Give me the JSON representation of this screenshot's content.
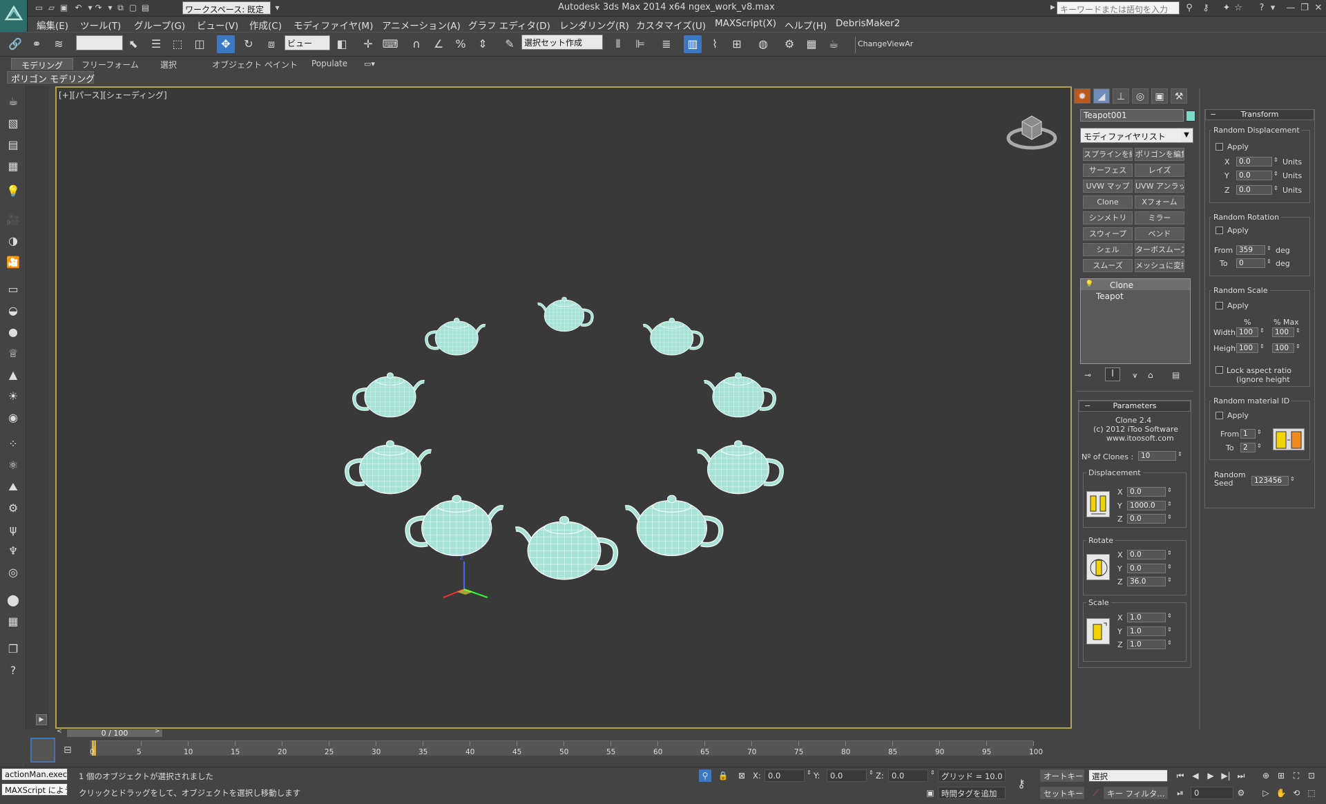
{
  "titlebar": {
    "workspace": "ワークスペース: 既定",
    "title": "Autodesk 3ds Max  2014 x64      ngex_work_v8.max",
    "search_placeholder": "キーワードまたは語句を入力"
  },
  "menu": [
    "編集(E)",
    "ツール(T)",
    "グループ(G)",
    "ビュー(V)",
    "作成(C)",
    "モディファイヤ(M)",
    "アニメーション(A)",
    "グラフ エディタ(D)",
    "レンダリング(R)",
    "カスタマイズ(U)",
    "MAXScript(X)",
    "ヘルプ(H)",
    "DebrisMaker2"
  ],
  "toolbar": {
    "view_dropdown": "ビュー",
    "selection_set": "選択セット作成",
    "change_view": "ChangeViewAr"
  },
  "ribbon": {
    "tabs": [
      "モデリング",
      "フリーフォーム",
      "選択",
      "オブジェクト ペイント",
      "Populate"
    ],
    "panel_label": "ポリゴン モデリング"
  },
  "viewport": {
    "label": "[+][パース][シェーディング]",
    "object_color": "#9be0d0"
  },
  "command_panel": {
    "object_name": "Teapot001",
    "object_color": "#7bd8c6",
    "modifier_list": "モディファイヤリスト",
    "modifier_buttons": [
      "スプラインを編集",
      "ポリゴンを編集",
      "サーフェス",
      "レイズ",
      "UVW マップ",
      "UVW アンラップ",
      "Clone",
      "Xフォーム",
      "シンメトリ",
      "ミラー",
      "スウィープ",
      "ベンド",
      "シェル",
      "ターボスムーズ",
      "スムーズ",
      "メッシュに変換"
    ],
    "stack": [
      "Clone",
      "Teapot"
    ]
  },
  "parameters": {
    "title": "Parameters",
    "about_lines": [
      "Clone 2.4",
      "(c) 2012 iToo Software",
      "www.itoosoft.com"
    ],
    "num_clones_label": "Nº of Clones :",
    "num_clones": "10",
    "displacement_label": "Displacement",
    "displacement": {
      "x": "0.0",
      "y": "1000.0",
      "z": "0.0"
    },
    "rotate_label": "Rotate",
    "rotate": {
      "x": "0.0",
      "y": "0.0",
      "z": "36.0"
    },
    "scale_label": "Scale",
    "scale": {
      "x": "1.0",
      "y": "1.0",
      "z": "1.0"
    },
    "axis_labels": [
      "X",
      "Y",
      "Z"
    ]
  },
  "transform": {
    "title": "Transform",
    "random_displacement": "Random Displacement",
    "apply": "Apply",
    "rd_values": {
      "x": "0.0",
      "y": "0.0",
      "z": "0.0"
    },
    "units": "Units",
    "random_rotation": "Random Rotation",
    "from_label": "From",
    "to_label": "To",
    "rr_from": "359",
    "rr_to": "0",
    "deg": "deg",
    "random_scale": "Random Scale",
    "pct": "%",
    "pct_max": "% Max",
    "width_label": "Width",
    "height_label": "Height",
    "rs_width": "100",
    "rs_width_max": "100",
    "rs_height": "100",
    "rs_height_max": "100",
    "lock_line1": "Lock aspect ratio",
    "lock_line2": "(ignore height",
    "random_material": "Random material ID",
    "rm_from": "1",
    "rm_to": "2",
    "random_seed_line1": "Random",
    "random_seed_line2": "Seed",
    "seed": "123456"
  },
  "timeline": {
    "frame": "0 / 100",
    "ticks": [
      "0",
      "5",
      "10",
      "15",
      "20",
      "25",
      "30",
      "35",
      "40",
      "45",
      "50",
      "55",
      "60",
      "65",
      "70",
      "75",
      "80",
      "85",
      "90",
      "95",
      "100"
    ]
  },
  "status": {
    "listener1": "actionMan.executi",
    "listener2": "MAXScript によう",
    "message1": "1 個のオブジェクトが選択されました",
    "message2": "クリックとドラッグをして、オブジェクトを選択し移動します",
    "x_label": "X:",
    "x": "0.0",
    "y_label": "Y:",
    "y": "0.0",
    "z_label": "Z:",
    "z": "0.0",
    "grid": "グリッド = 10.0",
    "add_time_tag": "時間タグを追加",
    "autokey": "オートキー",
    "setkey": "セットキー",
    "selection": "選択",
    "key_filter": "キー フィルタ...",
    "frame_field": "0"
  }
}
